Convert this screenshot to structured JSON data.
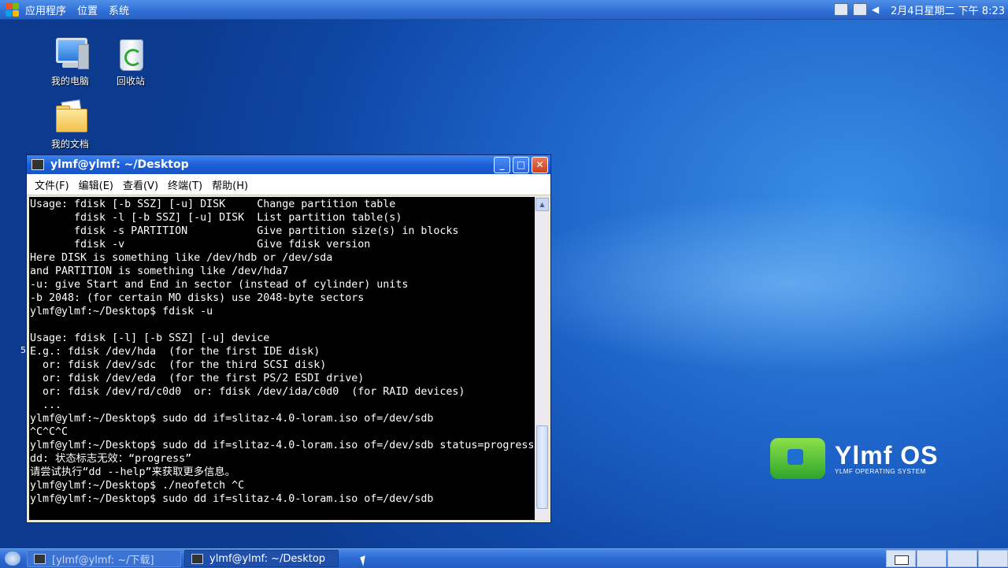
{
  "top_panel": {
    "menus": [
      "应用程序",
      "位置",
      "系统"
    ],
    "clock": "2月4日星期二 下午 8:23",
    "tray_icons": [
      "network-icon",
      "battery-icon",
      "volume-icon"
    ]
  },
  "desktop_icons": [
    {
      "label": "我的电脑",
      "icon": "computer-icon"
    },
    {
      "label": "回收站",
      "icon": "trash-icon"
    },
    {
      "label": "我的文档",
      "icon": "documents-folder-icon"
    }
  ],
  "stray_char": "5",
  "brand": {
    "title": "Ylmf OS",
    "subtitle": "YLMF OPERATING SYSTEM"
  },
  "window": {
    "title": "ylmf@ylmf: ~/Desktop",
    "menus": [
      "文件(F)",
      "编辑(E)",
      "查看(V)",
      "终端(T)",
      "帮助(H)"
    ],
    "terminal_lines": [
      "Usage: fdisk [-b SSZ] [-u] DISK     Change partition table",
      "       fdisk -l [-b SSZ] [-u] DISK  List partition table(s)",
      "       fdisk -s PARTITION           Give partition size(s) in blocks",
      "       fdisk -v                     Give fdisk version",
      "Here DISK is something like /dev/hdb or /dev/sda",
      "and PARTITION is something like /dev/hda7",
      "-u: give Start and End in sector (instead of cylinder) units",
      "-b 2048: (for certain MO disks) use 2048-byte sectors",
      "ylmf@ylmf:~/Desktop$ fdisk -u",
      "",
      "Usage: fdisk [-l] [-b SSZ] [-u] device",
      "E.g.: fdisk /dev/hda  (for the first IDE disk)",
      "  or: fdisk /dev/sdc  (for the third SCSI disk)",
      "  or: fdisk /dev/eda  (for the first PS/2 ESDI drive)",
      "  or: fdisk /dev/rd/c0d0  or: fdisk /dev/ida/c0d0  (for RAID devices)",
      "  ...",
      "ylmf@ylmf:~/Desktop$ sudo dd if=slitaz-4.0-loram.iso of=/dev/sdb",
      "^C^C^C",
      "ylmf@ylmf:~/Desktop$ sudo dd if=slitaz-4.0-loram.iso of=/dev/sdb status=progress",
      "dd: 状态标志无效：“progress”",
      "请尝试执行“dd --help”来获取更多信息。",
      "ylmf@ylmf:~/Desktop$ ./neofetch ^C",
      "ylmf@ylmf:~/Desktop$ sudo dd if=slitaz-4.0-loram.iso of=/dev/sdb"
    ]
  },
  "taskbar": {
    "buttons": [
      {
        "label": "[ylmf@ylmf: ~/下载]",
        "active": false
      },
      {
        "label": "ylmf@ylmf: ~/Desktop",
        "active": true
      }
    ]
  }
}
